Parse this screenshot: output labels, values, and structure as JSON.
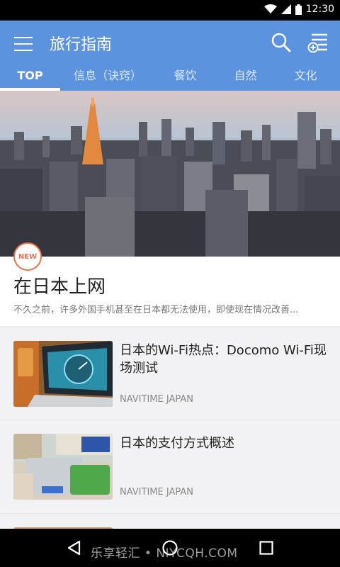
{
  "status_bar": {
    "time": "12:30",
    "icons": [
      "wifi-icon",
      "signal-icon",
      "battery-icon"
    ]
  },
  "app_bar": {
    "title": "旅行指南",
    "actions": [
      "menu-icon",
      "search-icon",
      "add-list-icon"
    ]
  },
  "tabs": [
    {
      "label": "TOP",
      "active": true
    },
    {
      "label": "信息（诀窍）",
      "active": false
    },
    {
      "label": "餐饮",
      "active": false
    },
    {
      "label": "自然",
      "active": false
    },
    {
      "label": "文化",
      "active": false
    }
  ],
  "featured": {
    "badge": "NEW",
    "title": "在日本上网",
    "summary": "不久之前，许多外国手机甚至在日本都无法使用，即使现在情况改善..."
  },
  "articles": [
    {
      "title": "日本的Wi-Fi热点：Docomo Wi-Fi现场测试",
      "source": "NAVITIME JAPAN",
      "thumb_icon": "laptop-speedtest-image"
    },
    {
      "title": "日本的支付方式概述",
      "source": "NAVITIME JAPAN",
      "thumb_icon": "payment-cards-image"
    }
  ],
  "nav_bar": {
    "watermark": "乐享轻汇 • NIYCQH.COM",
    "buttons": [
      "back-icon",
      "home-icon",
      "recents-icon"
    ]
  },
  "colors": {
    "app_bar": "#5b93df",
    "accent_new": "#f07049",
    "background": "#f2f2f4"
  }
}
